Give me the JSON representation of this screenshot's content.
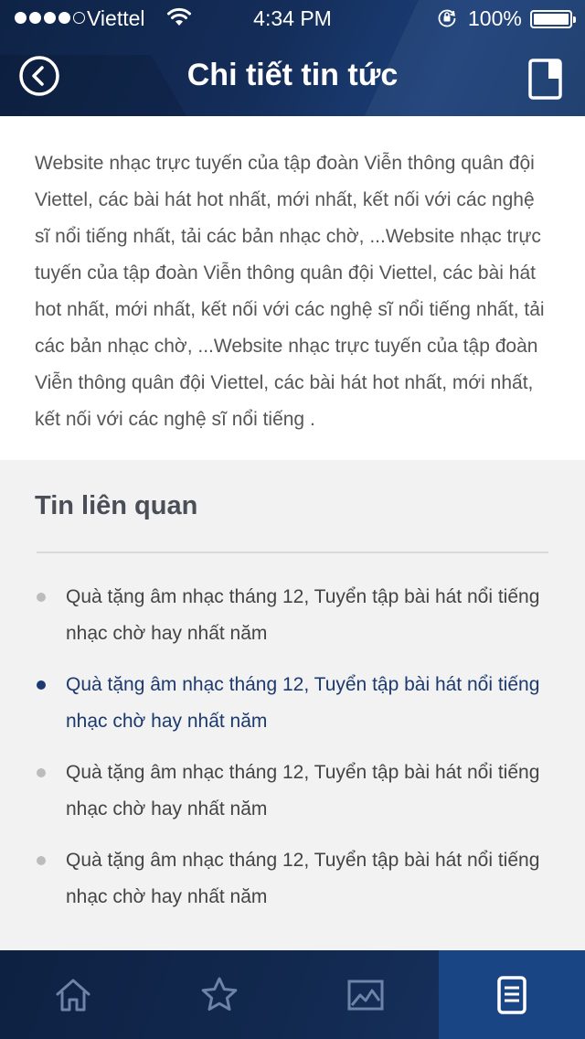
{
  "status_bar": {
    "carrier": "Viettel",
    "time": "4:34 PM",
    "battery": "100%"
  },
  "header": {
    "title": "Chi tiết tin tức",
    "back_icon": "back-circle-icon",
    "right_icon": "document-icon"
  },
  "article": {
    "body": "Website nhạc trực tuyến của tập đoàn Viễn thông quân đội Viettel, các bài hát hot nhất, mới nhất, kết nối với các nghệ sĩ nổi tiếng nhất, tải các bản nhạc chờ, ...Website nhạc trực tuyến của tập đoàn Viễn thông quân đội Viettel, các bài hát hot nhất, mới nhất, kết nối với các nghệ sĩ nổi tiếng nhất, tải các bản nhạc chờ, ...Website nhạc trực tuyến của tập đoàn Viễn thông quân đội Viettel, các bài hát hot nhất, mới nhất, kết nối với các nghệ sĩ nổi tiếng ."
  },
  "related": {
    "title": "Tin liên quan",
    "items": [
      {
        "text": "Quà tặng âm nhạc tháng 12, Tuyển tập bài hát nổi tiếng nhạc chờ hay nhất năm",
        "active": false
      },
      {
        "text": "Quà tặng âm nhạc tháng 12, Tuyển tập bài hát nổi tiếng nhạc chờ hay nhất năm",
        "active": true
      },
      {
        "text": "Quà tặng âm nhạc tháng 12, Tuyển tập bài hát nổi tiếng nhạc chờ hay nhất năm",
        "active": false
      },
      {
        "text": "Quà tặng âm nhạc tháng 12, Tuyển tập bài hát nổi tiếng nhạc chờ hay nhất năm",
        "active": false
      }
    ]
  },
  "tabbar": {
    "tabs": [
      {
        "icon": "home-icon",
        "active": false
      },
      {
        "icon": "star-icon",
        "active": false
      },
      {
        "icon": "image-icon",
        "active": false
      },
      {
        "icon": "news-icon",
        "active": true
      }
    ]
  },
  "colors": {
    "header_bg": "#142d59",
    "accent": "#1d3a6e",
    "active_tab": "#1a4585",
    "bullet_inactive": "#bcbcbc"
  }
}
